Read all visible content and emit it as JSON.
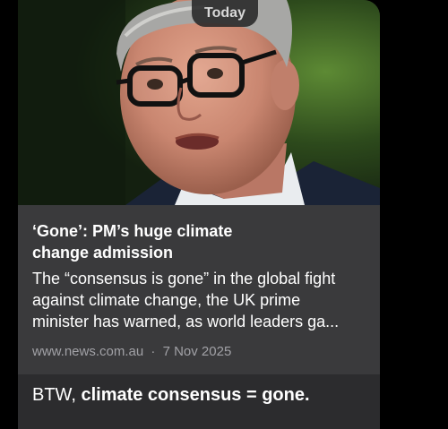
{
  "date_separator": "Today",
  "link_preview": {
    "title_line1": "‘Gone’: PM’s huge climate",
    "title_line2": "change admission",
    "description_line1": "The “consensus is gone” in the global fight",
    "description_line2": "against climate change, the UK prime",
    "description_line3": "minister has warned, as world leaders ga...",
    "source": "www.news.com.au",
    "separator": "·",
    "date": "7 Nov 2025"
  },
  "message": {
    "prefix": "BTW, ",
    "emphasis": "climate consensus = gone."
  }
}
